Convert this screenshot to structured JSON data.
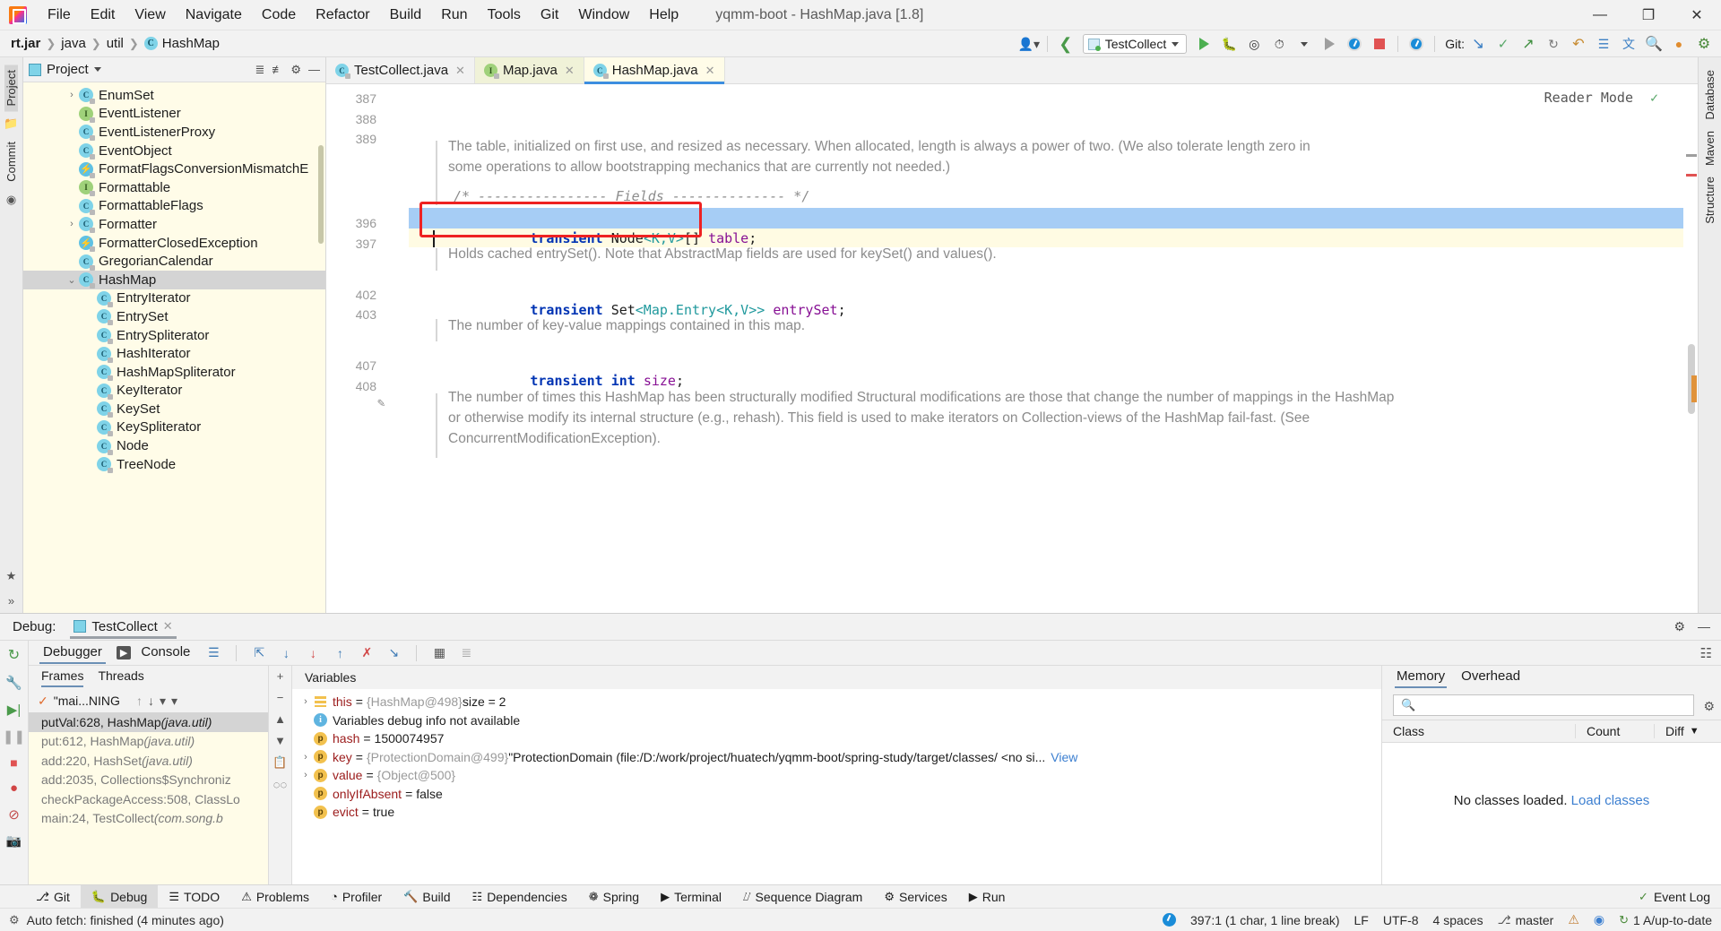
{
  "window": {
    "title": "yqmm-boot - HashMap.java [1.8]",
    "minimize": "—",
    "maximize": "❐",
    "close": "✕"
  },
  "menu": {
    "items": [
      "File",
      "Edit",
      "View",
      "Navigate",
      "Code",
      "Refactor",
      "Build",
      "Run",
      "Tools",
      "Git",
      "Window",
      "Help"
    ]
  },
  "breadcrumb": {
    "items": [
      "rt.jar",
      "java",
      "util",
      "HashMap"
    ],
    "class_badge": "C"
  },
  "toolbar": {
    "run_config": "TestCollect",
    "git_label": "Git:",
    "icons": [
      "user-icon",
      "back-arrow-icon",
      "run-icon",
      "debug-icon",
      "coverage-icon",
      "profile-icon",
      "rerun-icon",
      "attach-icon",
      "stop-icon",
      "search-icon",
      "updates-icon",
      "settings-icon"
    ]
  },
  "project_panel": {
    "title": "Project",
    "actions": [
      "collapse-all-icon",
      "expand-icon",
      "settings-icon",
      "hide-icon"
    ],
    "tree": [
      {
        "label": "EnumSet",
        "icon": "class",
        "indent": 2,
        "arrow": "right",
        "selected": false
      },
      {
        "label": "EventListener",
        "icon": "interface",
        "indent": 2,
        "arrow": "none",
        "selected": false
      },
      {
        "label": "EventListenerProxy",
        "icon": "class",
        "indent": 2,
        "arrow": "none",
        "selected": false
      },
      {
        "label": "EventObject",
        "icon": "class",
        "indent": 2,
        "arrow": "none",
        "selected": false
      },
      {
        "label": "FormatFlagsConversionMismatchE",
        "icon": "exception",
        "indent": 2,
        "arrow": "none",
        "selected": false
      },
      {
        "label": "Formattable",
        "icon": "interface",
        "indent": 2,
        "arrow": "none",
        "selected": false
      },
      {
        "label": "FormattableFlags",
        "icon": "class",
        "indent": 2,
        "arrow": "none",
        "selected": false
      },
      {
        "label": "Formatter",
        "icon": "class",
        "indent": 2,
        "arrow": "right",
        "selected": false
      },
      {
        "label": "FormatterClosedException",
        "icon": "exception",
        "indent": 2,
        "arrow": "none",
        "selected": false
      },
      {
        "label": "GregorianCalendar",
        "icon": "class",
        "indent": 2,
        "arrow": "none",
        "selected": false
      },
      {
        "label": "HashMap",
        "icon": "class",
        "indent": 2,
        "arrow": "down",
        "selected": true
      },
      {
        "label": "EntryIterator",
        "icon": "class",
        "indent": 3,
        "arrow": "none",
        "selected": false
      },
      {
        "label": "EntrySet",
        "icon": "class",
        "indent": 3,
        "arrow": "none",
        "selected": false
      },
      {
        "label": "EntrySpliterator",
        "icon": "class",
        "indent": 3,
        "arrow": "none",
        "selected": false
      },
      {
        "label": "HashIterator",
        "icon": "class",
        "indent": 3,
        "arrow": "none",
        "selected": false
      },
      {
        "label": "HashMapSpliterator",
        "icon": "class",
        "indent": 3,
        "arrow": "none",
        "selected": false
      },
      {
        "label": "KeyIterator",
        "icon": "class",
        "indent": 3,
        "arrow": "none",
        "selected": false
      },
      {
        "label": "KeySet",
        "icon": "class",
        "indent": 3,
        "arrow": "none",
        "selected": false
      },
      {
        "label": "KeySpliterator",
        "icon": "class",
        "indent": 3,
        "arrow": "none",
        "selected": false
      },
      {
        "label": "Node",
        "icon": "class",
        "indent": 3,
        "arrow": "none",
        "selected": false
      },
      {
        "label": "TreeNode",
        "icon": "class",
        "indent": 3,
        "arrow": "none",
        "selected": false
      }
    ]
  },
  "rails": {
    "left": [
      "Project",
      "Commit"
    ],
    "right": [
      "Database",
      "Maven",
      "Structure"
    ],
    "bottom_left_icon": "favorites-star-icon"
  },
  "editor": {
    "tabs": [
      {
        "label": "TestCollect.java",
        "icon": "class",
        "active": false
      },
      {
        "label": "Map.java",
        "icon": "interface",
        "active": false
      },
      {
        "label": "HashMap.java",
        "icon": "class",
        "active": true
      }
    ],
    "reader_mode": "Reader Mode",
    "line_numbers": [
      "387",
      "388",
      "389",
      "396",
      "397",
      "402",
      "403",
      "407",
      "408"
    ],
    "comment_banner": "/* ---------------- Fields -------------- */",
    "docs": [
      {
        "lines": [
          "The table, initialized on first use, and resized as necessary. When allocated, length is always a power",
          "of two. (We also tolerate length zero in some operations to allow bootstrapping mechanics that are",
          "currently not needed.)"
        ]
      },
      {
        "lines": [
          "Holds cached entrySet(). Note that AbstractMap fields are used for keySet() and values()."
        ]
      },
      {
        "lines": [
          "The number of key-value mappings contained in this map."
        ]
      },
      {
        "lines": [
          "The number of times this HashMap has been structurally modified Structural modifications are those",
          "that change the number of mappings in the HashMap or otherwise modify its internal structure (e.g.,",
          "rehash). This field is used to make iterators on Collection-views of the HashMap fail-fast. (See",
          "ConcurrentModificationException)."
        ]
      }
    ],
    "code": {
      "line396": {
        "kw": "transient",
        "type": "Node",
        "generics": "<K,V>",
        "arr": "[] ",
        "field": "table",
        "semi": ";"
      },
      "line402": {
        "kw": "transient",
        "type": "Set",
        "generics": "<Map.Entry<K,V>>",
        "arr": " ",
        "field": "entrySet",
        "semi": ";"
      },
      "line407": {
        "kw": "transient",
        "type2": "int",
        "field": "size",
        "semi": ";"
      }
    }
  },
  "debug": {
    "header_label": "Debug:",
    "session_tab": "TestCollect",
    "tabs": [
      {
        "label": "Debugger",
        "active": true
      },
      {
        "label": "Console",
        "active": false
      }
    ],
    "toolbar_icons": [
      "layout-icon",
      "step-over-icon",
      "step-into-icon",
      "force-step-into-icon",
      "step-out-icon",
      "drop-frame-icon",
      "run-to-cursor-icon",
      "evaluate-icon",
      "settings-icon"
    ],
    "rail_icons": [
      "rerun-icon",
      "settings-wrench-icon",
      "resume-icon",
      "pause-icon",
      "stop-icon",
      "breakpoints-icon",
      "mute-breakpoints-icon",
      "camera-icon",
      "binoculars-icon"
    ],
    "frames": {
      "subtabs": [
        {
          "label": "Frames",
          "active": true
        },
        {
          "label": "Threads",
          "active": false
        }
      ],
      "thread": "\"mai...NING",
      "thread_icons": [
        "up-arrow-icon",
        "down-arrow-icon",
        "filter-icon",
        "chevron-down-icon"
      ],
      "list": [
        {
          "text": "putVal:628, HashMap ",
          "pkg": "(java.util)",
          "selected": true
        },
        {
          "text": "put:612, HashMap ",
          "pkg": "(java.util)",
          "selected": false
        },
        {
          "text": "add:220, HashSet ",
          "pkg": "(java.util)",
          "selected": false
        },
        {
          "text": "add:2035, Collections$Synchroniz",
          "pkg": "",
          "selected": false
        },
        {
          "text": "checkPackageAccess:508, ClassLo",
          "pkg": "",
          "selected": false
        },
        {
          "text": "main:24, TestCollect ",
          "pkg": "(com.song.b",
          "selected": false
        }
      ]
    },
    "variables": {
      "header": "Variables",
      "side_icons": [
        "add-icon",
        "remove-icon",
        "up-icon",
        "down-icon",
        "copy-icon",
        "link-icon"
      ],
      "rows": [
        {
          "expandable": true,
          "icon": "list",
          "name": "this",
          "eq": "=",
          "ref": "{HashMap@498}",
          "value": "size = 2",
          "link": "",
          "red": true
        },
        {
          "expandable": false,
          "icon": "info",
          "name": "",
          "eq": "",
          "ref": "",
          "value": "Variables debug info not available",
          "link": "",
          "red": false
        },
        {
          "expandable": false,
          "icon": "p",
          "name": "hash",
          "eq": "=",
          "ref": "",
          "value": "1500074957",
          "link": "",
          "red": true
        },
        {
          "expandable": true,
          "icon": "p",
          "name": "key",
          "eq": "=",
          "ref": "{ProtectionDomain@499}",
          "value": "\"ProtectionDomain  (file:/D:/work/project/huatech/yqmm-boot/spring-study/target/classes/ <no si...",
          "link": "View",
          "red": true
        },
        {
          "expandable": true,
          "icon": "p",
          "name": "value",
          "eq": "=",
          "ref": "{Object@500}",
          "value": "",
          "link": "",
          "red": true
        },
        {
          "expandable": false,
          "icon": "p",
          "name": "onlyIfAbsent",
          "eq": "=",
          "ref": "",
          "value": "false",
          "link": "",
          "red": true
        },
        {
          "expandable": false,
          "icon": "p",
          "name": "evict",
          "eq": "=",
          "ref": "",
          "value": "true",
          "link": "",
          "red": true
        }
      ]
    },
    "memory": {
      "tabs": [
        {
          "label": "Memory",
          "active": true
        },
        {
          "label": "Overhead",
          "active": false
        }
      ],
      "search_placeholder": "",
      "columns": [
        "Class",
        "Count",
        "Diff"
      ],
      "empty_text": "No classes loaded.",
      "empty_link": "Load classes"
    }
  },
  "toolstrip": {
    "items": [
      {
        "label": "Git",
        "icon": "git-icon",
        "active": false
      },
      {
        "label": "Debug",
        "icon": "debug-icon",
        "active": true
      },
      {
        "label": "TODO",
        "icon": "todo-icon",
        "active": false
      },
      {
        "label": "Problems",
        "icon": "problems-icon",
        "active": false
      },
      {
        "label": "Profiler",
        "icon": "profiler-icon",
        "active": false
      },
      {
        "label": "Build",
        "icon": "build-icon",
        "active": false
      },
      {
        "label": "Dependencies",
        "icon": "dependencies-icon",
        "active": false
      },
      {
        "label": "Spring",
        "icon": "spring-icon",
        "active": false
      },
      {
        "label": "Terminal",
        "icon": "terminal-icon",
        "active": false
      },
      {
        "label": "Sequence Diagram",
        "icon": "sequence-diagram-icon",
        "active": false
      },
      {
        "label": "Services",
        "icon": "services-icon",
        "active": false
      },
      {
        "label": "Run",
        "icon": "run-icon",
        "active": false
      }
    ],
    "event_log": "Event Log"
  },
  "statusbar": {
    "message": "Auto fetch: finished (4 minutes ago)",
    "caret": "397:1 (1 char, 1 line break)",
    "line_sep": "LF",
    "encoding": "UTF-8",
    "indent": "4 spaces",
    "branch": "master",
    "updates": "1 A/up-to-date"
  },
  "colors": {
    "accent": "#3c8ee0",
    "highlight_box": "#ee2222",
    "selection": "#a6cdf5",
    "tree_bg": "#fffce8",
    "keyword": "#0033b3",
    "field": "#871094",
    "generic": "#20999d"
  }
}
